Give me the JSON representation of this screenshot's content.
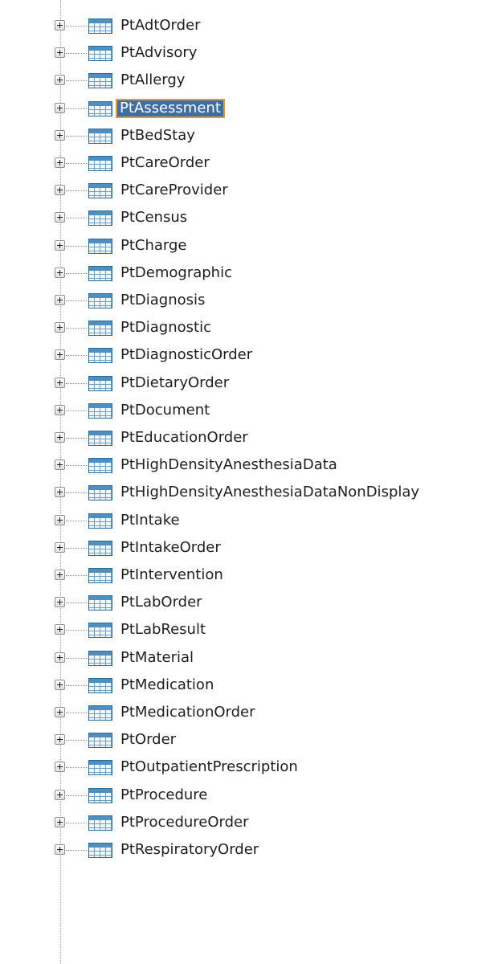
{
  "tree": {
    "selected_index": 3,
    "items": [
      {
        "label": "PtAdtOrder"
      },
      {
        "label": "PtAdvisory"
      },
      {
        "label": "PtAllergy"
      },
      {
        "label": "PtAssessment"
      },
      {
        "label": "PtBedStay"
      },
      {
        "label": "PtCareOrder"
      },
      {
        "label": "PtCareProvider"
      },
      {
        "label": "PtCensus"
      },
      {
        "label": "PtCharge"
      },
      {
        "label": "PtDemographic"
      },
      {
        "label": "PtDiagnosis"
      },
      {
        "label": "PtDiagnostic"
      },
      {
        "label": "PtDiagnosticOrder"
      },
      {
        "label": "PtDietaryOrder"
      },
      {
        "label": "PtDocument"
      },
      {
        "label": "PtEducationOrder"
      },
      {
        "label": "PtHighDensityAnesthesiaData"
      },
      {
        "label": "PtHighDensityAnesthesiaDataNonDisplay"
      },
      {
        "label": "PtIntake"
      },
      {
        "label": "PtIntakeOrder"
      },
      {
        "label": "PtIntervention"
      },
      {
        "label": "PtLabOrder"
      },
      {
        "label": "PtLabResult"
      },
      {
        "label": "PtMaterial"
      },
      {
        "label": "PtMedication"
      },
      {
        "label": "PtMedicationOrder"
      },
      {
        "label": "PtOrder"
      },
      {
        "label": "PtOutpatientPrescription"
      },
      {
        "label": "PtProcedure"
      },
      {
        "label": "PtProcedureOrder"
      },
      {
        "label": "PtRespiratoryOrder"
      }
    ]
  },
  "icons": {
    "expander": "expand-plus-icon",
    "node": "table-icon"
  },
  "colors": {
    "selection_background": "#3d6fa5",
    "selection_border": "#e59a2a",
    "text": "#1e1e1e"
  }
}
